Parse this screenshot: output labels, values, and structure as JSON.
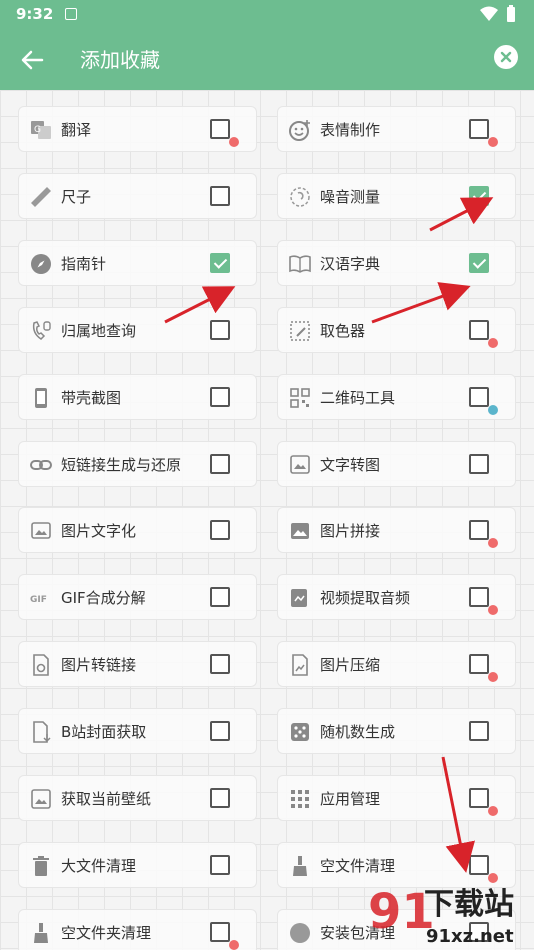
{
  "status_bar": {
    "time": "9:32"
  },
  "header": {
    "title": "添加收藏"
  },
  "colors": {
    "accent": "#6dbd90",
    "dot_red": "#ef6b6b",
    "dot_blue": "#5bb5cc",
    "arrow": "#d8232a"
  },
  "tools": [
    {
      "label": "翻译",
      "icon": "translate-icon",
      "checked": false,
      "dot": "red"
    },
    {
      "label": "表情制作",
      "icon": "emoji-icon",
      "checked": false,
      "dot": "red"
    },
    {
      "label": "尺子",
      "icon": "ruler-icon",
      "checked": false,
      "dot": ""
    },
    {
      "label": "噪音测量",
      "icon": "noise-meter-icon",
      "checked": true,
      "dot": ""
    },
    {
      "label": "指南针",
      "icon": "compass-icon",
      "checked": true,
      "dot": ""
    },
    {
      "label": "汉语字典",
      "icon": "dictionary-icon",
      "checked": true,
      "dot": ""
    },
    {
      "label": "归属地查询",
      "icon": "phone-location-icon",
      "checked": false,
      "dot": ""
    },
    {
      "label": "取色器",
      "icon": "color-picker-icon",
      "checked": false,
      "dot": "red"
    },
    {
      "label": "带壳截图",
      "icon": "phone-frame-screenshot-icon",
      "checked": false,
      "dot": ""
    },
    {
      "label": "二维码工具",
      "icon": "qrcode-icon",
      "checked": false,
      "dot": "blue"
    },
    {
      "label": "短链接生成与还原",
      "icon": "link-icon",
      "checked": false,
      "dot": ""
    },
    {
      "label": "文字转图",
      "icon": "text-to-image-icon",
      "checked": false,
      "dot": ""
    },
    {
      "label": "图片文字化",
      "icon": "image-text-icon",
      "checked": false,
      "dot": ""
    },
    {
      "label": "图片拼接",
      "icon": "image-icon",
      "checked": false,
      "dot": "red"
    },
    {
      "label": "GIF合成分解",
      "icon": "gif-icon",
      "checked": false,
      "dot": ""
    },
    {
      "label": "视频提取音频",
      "icon": "video-audio-icon",
      "checked": false,
      "dot": "red"
    },
    {
      "label": "图片转链接",
      "icon": "image-link-icon",
      "checked": false,
      "dot": ""
    },
    {
      "label": "图片压缩",
      "icon": "image-compress-icon",
      "checked": false,
      "dot": "red"
    },
    {
      "label": "B站封面获取",
      "icon": "file-download-icon",
      "checked": false,
      "dot": ""
    },
    {
      "label": "随机数生成",
      "icon": "dice-icon",
      "checked": false,
      "dot": ""
    },
    {
      "label": "获取当前壁纸",
      "icon": "wallpaper-icon",
      "checked": false,
      "dot": ""
    },
    {
      "label": "应用管理",
      "icon": "apps-grid-icon",
      "checked": false,
      "dot": "red"
    },
    {
      "label": "大文件清理",
      "icon": "trash-icon",
      "checked": false,
      "dot": ""
    },
    {
      "label": "空文件清理",
      "icon": "broom-icon",
      "checked": false,
      "dot": "red"
    },
    {
      "label": "空文件夹清理",
      "icon": "broom-icon",
      "checked": false,
      "dot": "red"
    },
    {
      "label": "安装包清理",
      "icon": "package-icon",
      "checked": false,
      "dot": ""
    }
  ],
  "watermark": {
    "text": "下载站",
    "url": "91xz.net"
  }
}
